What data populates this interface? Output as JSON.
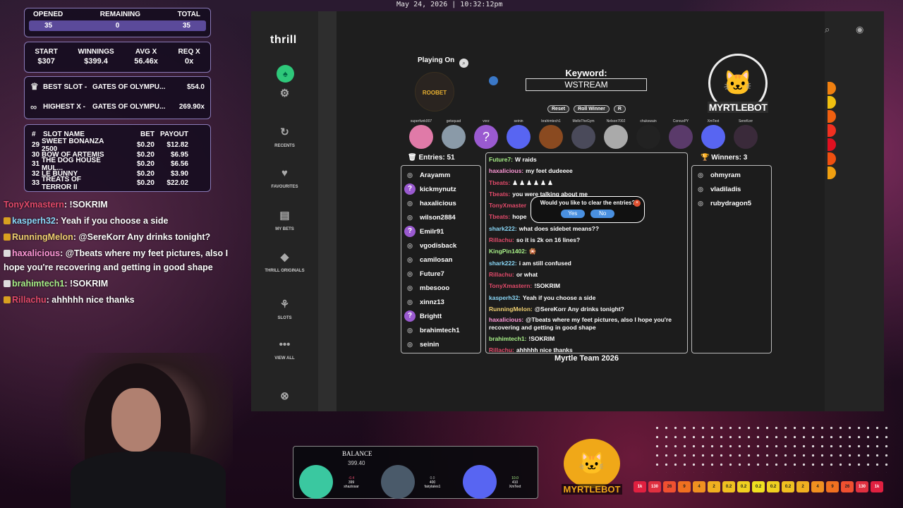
{
  "datetime": "May 24, 2026 | 10:32:12pm",
  "stats": {
    "opened_label": "OPENED",
    "remaining_label": "REMAINING",
    "total_label": "TOTAL",
    "opened": "35",
    "remaining": "0",
    "total": "35",
    "start_label": "START",
    "winnings_label": "WINNINGS",
    "avg_label": "AVG X",
    "req_label": "REQ X",
    "start": "$307",
    "winnings": "$399.4",
    "avg": "56.46x",
    "req": "0x",
    "best_label": "BEST SLOT -",
    "best_game": "GATES OF OLYMPU...",
    "best_value": "$54.0",
    "highest_label": "HIGHEST X -",
    "highest_game": "GATES OF OLYMPU...",
    "highest_value": "269.90x"
  },
  "slot_table": {
    "headers": [
      "#",
      "SLOT NAME",
      "BET",
      "PAYOUT"
    ],
    "rows": [
      [
        "29",
        "SWEET BONANZA 2500",
        "$0.20",
        "$12.82"
      ],
      [
        "30",
        "BOW OF ARTEMIS",
        "$0.20",
        "$6.95"
      ],
      [
        "31",
        "THE DOG HOUSE MUL...",
        "$0.20",
        "$6.56"
      ],
      [
        "32",
        "LE BUNNY",
        "$0.20",
        "$3.90"
      ],
      [
        "33",
        "TREATS OF TERROR II",
        "$0.20",
        "$22.02"
      ]
    ]
  },
  "stream_chat": [
    {
      "user": "TonyXmastern",
      "msg": ": !SOKRIM",
      "color": "red"
    },
    {
      "user": "kasperh32",
      "msg": ": Yeah if you choose a side",
      "color": "bl"
    },
    {
      "user": "RunningMelon",
      "msg": ": @SereKorr Any drinks tonight?",
      "color": "or"
    },
    {
      "user": "haxalicious",
      "msg": ": @Tbeats where my feet pictures, also I hope you're recovering and getting in good shape",
      "color": "pk"
    },
    {
      "user": "brahimtech1",
      "msg": ": !SOKRIM",
      "color": "gr"
    },
    {
      "user": "Rillachu",
      "msg": ": ahhhhh nice thanks",
      "color": "red"
    }
  ],
  "app": {
    "logo": "thrill",
    "nav": [
      "RECENTS",
      "FAVOURITES",
      "MY BETS",
      "THRILL ORIGINALS",
      "SLOTS",
      "VIEW ALL"
    ],
    "playing_on": "Playing On",
    "casino": "ROOBET",
    "keyword_label": "Keyword:",
    "keyword": "WSTREAM",
    "bot_name": "MYRTLEBOT",
    "buttons": [
      "Reset",
      "Roll Winner",
      "R"
    ],
    "avatars": [
      "superfunk007",
      "getsquad",
      "vorz",
      "seinin",
      "brahimtech1",
      "MelloTheGym",
      "Nelson7002",
      "chukswain",
      "CorvusPY",
      "XmText",
      "SereKorr",
      "T"
    ],
    "entries_label": "Entries: 51",
    "winners_label": "Winners: 3",
    "entries": [
      "Arayamm",
      "kickmynutz",
      "haxalicious",
      "wilson2884",
      "Emilr91",
      "vgodisback",
      "camilosan",
      "Future7",
      "mbesooo",
      "xinnz13",
      "Brightt",
      "brahimtech1",
      "seinin"
    ],
    "winners": [
      "ohmyram",
      "vladiladis",
      "rubydragon5"
    ],
    "chat": [
      {
        "u": "Future7:",
        "m": "W raids",
        "c": "gr"
      },
      {
        "u": "haxalicious:",
        "m": "my feet dudeeee",
        "c": "pk"
      },
      {
        "u": "Tbeats:",
        "m": "♟ ♟ ♟ ♟ ♟ ♟",
        "c": "red"
      },
      {
        "u": "Tbeats:",
        "m": "you were talking about me",
        "c": "red"
      },
      {
        "u": "TonyXmaster",
        "m": "",
        "c": "red"
      },
      {
        "u": "Tbeats:",
        "m": "hope",
        "c": "red"
      },
      {
        "u": "shark222:",
        "m": "what does sidebet means??",
        "c": "bl"
      },
      {
        "u": "Rillachu:",
        "m": "so it is 2k on 16 lines?",
        "c": "red"
      },
      {
        "u": "KingPin1402:",
        "m": "🎇",
        "c": "gr"
      },
      {
        "u": "shark222:",
        "m": "i am still confused",
        "c": "bl"
      },
      {
        "u": "Rillachu:",
        "m": "or what",
        "c": "red"
      },
      {
        "u": "TonyXmastern:",
        "m": "!SOKRIM",
        "c": "red"
      },
      {
        "u": "kasperh32:",
        "m": "Yeah if you choose a side",
        "c": "bl"
      },
      {
        "u": "RunningMelon:",
        "m": "@SereKorr Any drinks tonight?",
        "c": "or"
      },
      {
        "u": "haxalicious:",
        "m": "@Tbeats where my feet pictures, also I hope you're recovering and getting in good shape",
        "c": "pk"
      },
      {
        "u": "brahimtech1:",
        "m": "!SOKRIM",
        "c": "gr"
      },
      {
        "u": "Rillachu:",
        "m": "ahhhhh nice thanks",
        "c": "red"
      }
    ],
    "dialog": {
      "text": "Would you like to clear the entries?",
      "yes": "Yes",
      "no": "No"
    },
    "footer": "Myrtle Team 2026"
  },
  "balance": {
    "label": "BALANCE",
    "value": "399.40",
    "slots": [
      {
        "top": "-0.4",
        "mid": "399",
        "name": "shaziosar"
      },
      {
        "top": "0.0",
        "mid": "400",
        "name": "fairytales1"
      },
      {
        "top": "10.0",
        "mid": "410",
        "name": "XmText"
      }
    ]
  },
  "bottom_logo": "MYRTLEBOT",
  "multipliers": [
    "1k",
    "130",
    "26",
    "9",
    "4",
    "2",
    "0.2",
    "0.2",
    "0.2",
    "0.2",
    "0.2",
    "2",
    "4",
    "9",
    "26",
    "130",
    "1k"
  ]
}
